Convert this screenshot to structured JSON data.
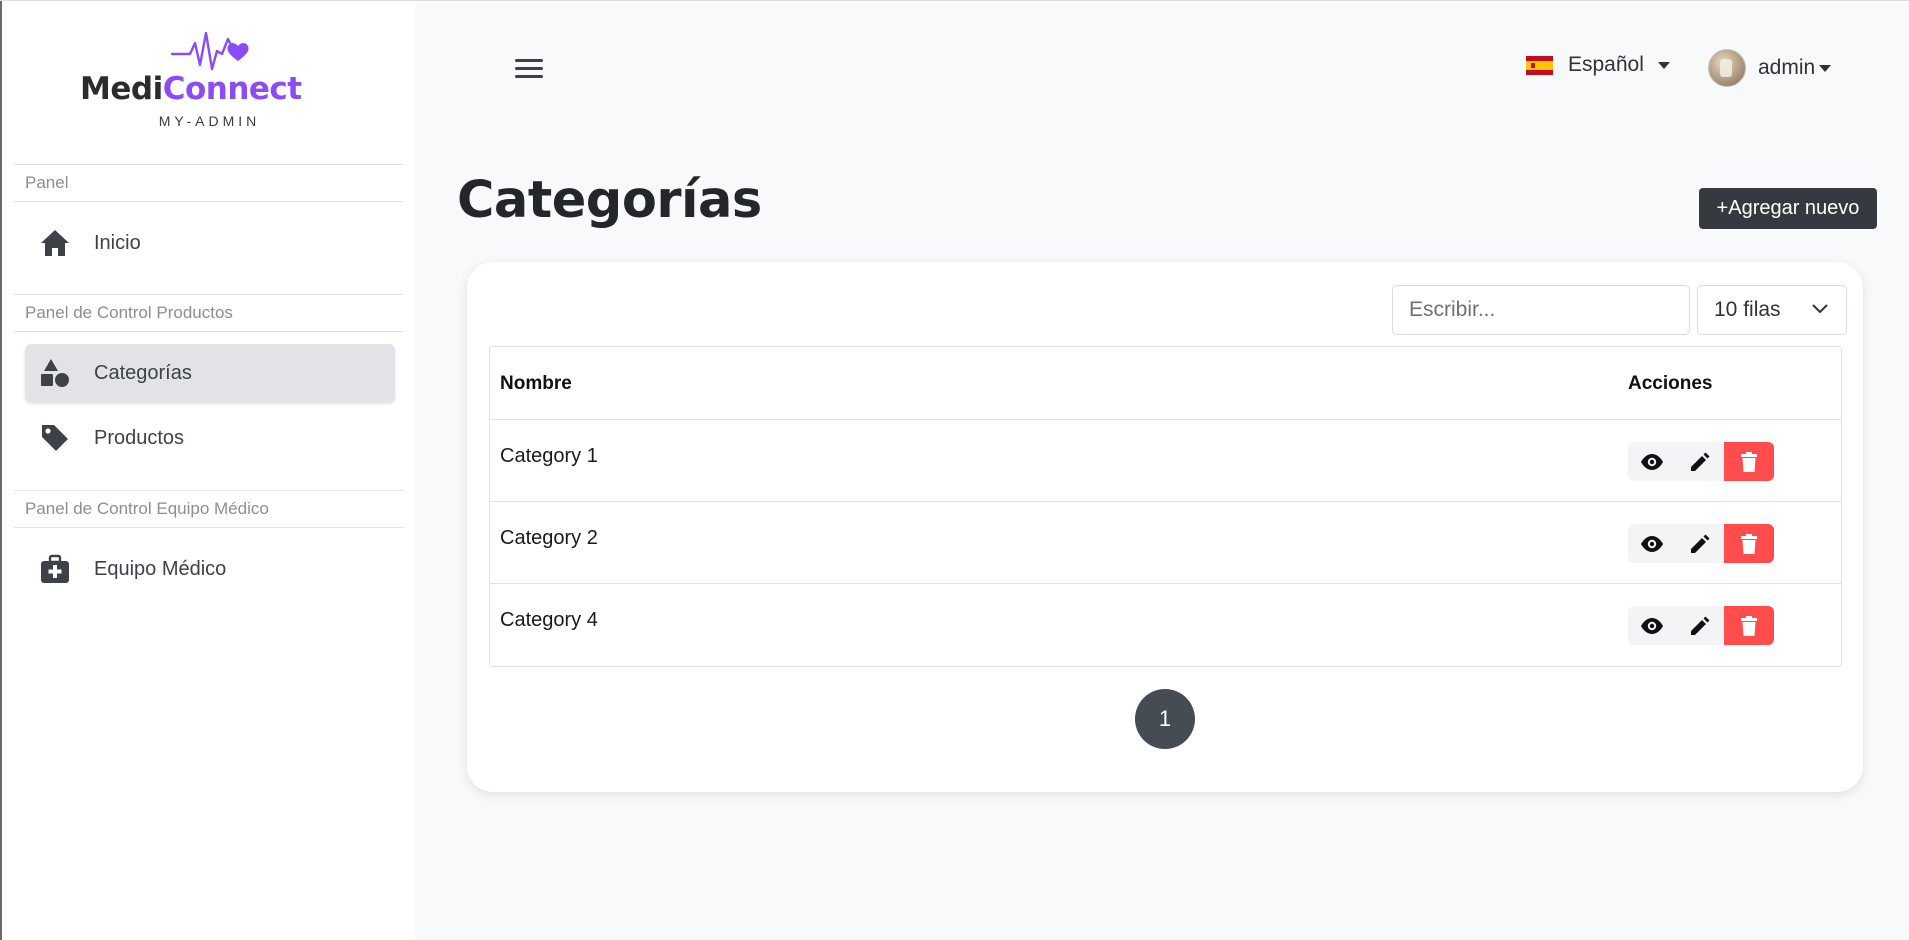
{
  "brand": {
    "name_part1": "Medi",
    "name_part2": "Connect",
    "subtitle": "MY-ADMIN",
    "primary_color": "#8b4cf6"
  },
  "sidebar": {
    "sections": [
      {
        "label": "Panel"
      },
      {
        "label": "Panel de Control Productos"
      },
      {
        "label": "Panel de Control Equipo Médico"
      }
    ],
    "items": [
      {
        "label": "Inicio",
        "icon": "home-icon"
      },
      {
        "label": "Categorías",
        "icon": "shapes-icon",
        "active": true
      },
      {
        "label": "Productos",
        "icon": "tag-icon"
      },
      {
        "label": "Equipo Médico",
        "icon": "medical-kit-icon"
      }
    ]
  },
  "header": {
    "language": "Español",
    "language_flag": "spain-flag-icon",
    "user": "admin"
  },
  "page": {
    "title": "Categorías",
    "add_button": "+Agregar nuevo"
  },
  "table": {
    "search_placeholder": "Escribir...",
    "rows_per_page": "10 filas",
    "columns": [
      "Nombre",
      "Acciones"
    ],
    "rows": [
      {
        "name": "Category 1"
      },
      {
        "name": "Category 2"
      },
      {
        "name": "Category 4"
      }
    ],
    "delete_color": "#ff4d4d"
  },
  "pagination": {
    "current_page": "1"
  }
}
